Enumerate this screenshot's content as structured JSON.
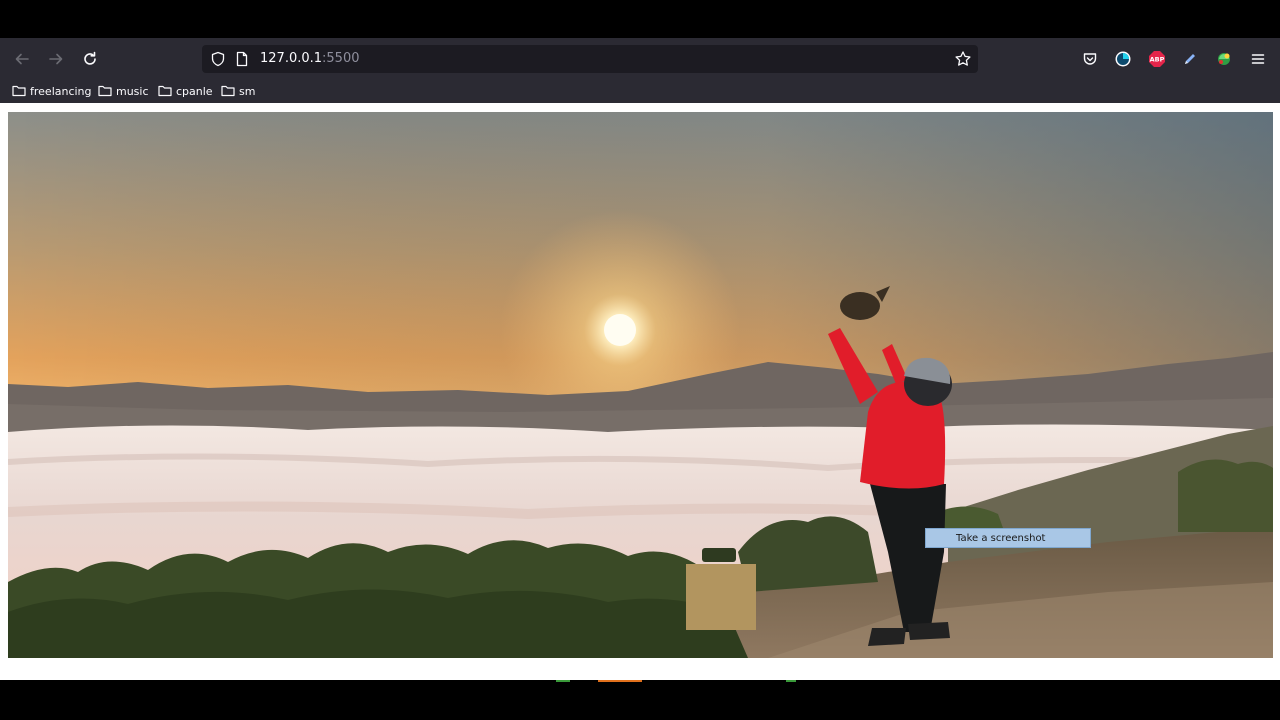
{
  "browser": {
    "url_host": "127.0.0.1",
    "url_port": ":5500",
    "nav": {
      "back_icon": "arrow-left-icon",
      "forward_icon": "arrow-right-icon",
      "reload_icon": "reload-icon"
    },
    "toolbar_icons": [
      "pocket-icon",
      "extension-blue-icon",
      "adblock-plus-icon",
      "pen-icon",
      "extension-green-icon",
      "menu-icon"
    ],
    "adblock_label": "ABP"
  },
  "bookmarks": [
    {
      "label": "freelancing",
      "icon": "folder-icon"
    },
    {
      "label": "music",
      "icon": "folder-icon"
    },
    {
      "label": "cpanle",
      "icon": "folder-icon"
    },
    {
      "label": "sm",
      "icon": "folder-icon"
    }
  ],
  "overlay": {
    "screenshot_label": "Take a screenshot"
  },
  "colors": {
    "toolbar": "#2b2a33",
    "urlbar": "#1c1b22",
    "jacket": "#e11d2a",
    "sky_top": "#7d8a91",
    "sun": "#fff6d6"
  }
}
